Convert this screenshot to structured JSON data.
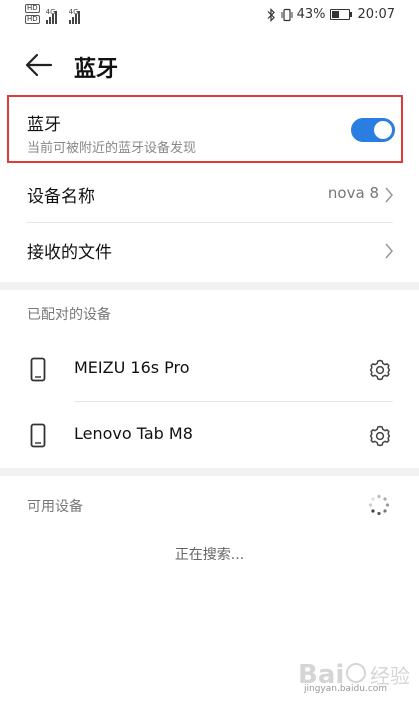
{
  "status_bar": {
    "hd1": "HD",
    "hd2": "HD",
    "network1": "4G",
    "network2": "4G",
    "battery_pct": "43%",
    "battery_level": 0.43,
    "time": "20:07",
    "icons": [
      "bluetooth-icon",
      "vibrate-icon",
      "battery-icon"
    ]
  },
  "header": {
    "title": "蓝牙",
    "back_icon": "arrow-left-icon"
  },
  "bluetooth": {
    "label": "蓝牙",
    "subtitle": "当前可被附近的蓝牙设备发现",
    "enabled": true,
    "toggle_color": "#2a7de1",
    "highlight_color": "#e03b3b"
  },
  "settings": {
    "device_name_label": "设备名称",
    "device_name_value": "nova 8",
    "received_files_label": "接收的文件"
  },
  "paired": {
    "header": "已配对的设备",
    "devices": [
      {
        "name": "MEIZU 16s Pro",
        "icon": "phone-icon"
      },
      {
        "name": "Lenovo Tab M8",
        "icon": "phone-icon"
      }
    ]
  },
  "available": {
    "header": "可用设备",
    "status": "正在搜索..."
  },
  "watermark": {
    "text": "jingyan.baidu.com"
  }
}
